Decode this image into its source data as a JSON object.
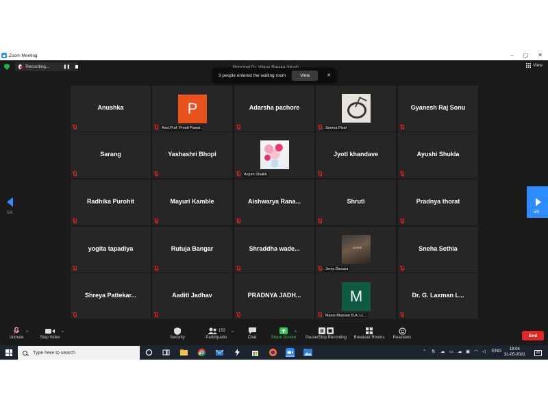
{
  "window": {
    "title": "Zoom Meeting",
    "controls": [
      "–",
      "▢",
      "✕"
    ]
  },
  "meeting_top": {
    "recording_label": "Recording...",
    "host_title": "Principal Dr. Vijaya Rajaka (Host)",
    "view_label": "View"
  },
  "notification": {
    "text": "3 people entered the waiting room",
    "view_button": "View",
    "close": "✕"
  },
  "navigation": {
    "page_left": "5/6",
    "page_right": "5/6"
  },
  "participants": [
    {
      "name": "Anushka",
      "type": "name"
    },
    {
      "name": "Asst.Prof. Preeti Pawar",
      "type": "avatar",
      "initial": "P",
      "color": "#e8521f"
    },
    {
      "name": "Adarsha pachore",
      "type": "name"
    },
    {
      "name": "Seema Pisal",
      "type": "photo",
      "photo": "sketch"
    },
    {
      "name": "Gyanesh Raj Sonu",
      "type": "name"
    },
    {
      "name": "Sarang",
      "type": "name"
    },
    {
      "name": "Yashashri Bhopi",
      "type": "name"
    },
    {
      "name": "Anjum Shaikh",
      "type": "photo",
      "photo": "flowers"
    },
    {
      "name": "Jyoti khandave",
      "type": "name"
    },
    {
      "name": "Ayushi Shukla",
      "type": "name"
    },
    {
      "name": "Radhika Purohit",
      "type": "name"
    },
    {
      "name": "Mayuri Kamble",
      "type": "name"
    },
    {
      "name": "Aishwarya  Rana...",
      "type": "name"
    },
    {
      "name": "Shruti",
      "type": "name"
    },
    {
      "name": "Pradnya thorat",
      "type": "name"
    },
    {
      "name": "yogita tapadiya",
      "type": "name"
    },
    {
      "name": "Rutuja Bangar",
      "type": "name"
    },
    {
      "name": "Shraddha  wade...",
      "type": "name"
    },
    {
      "name": "Jersy Dsouza",
      "type": "photo",
      "photo": "dark"
    },
    {
      "name": "Sneha Sethia",
      "type": "name"
    },
    {
      "name": "Shreya  Pattekar...",
      "type": "name"
    },
    {
      "name": "Aaditi Jadhav",
      "type": "name"
    },
    {
      "name": "PRADNYA  JADH...",
      "type": "name"
    },
    {
      "name": "Mansi Bhavsar B.A..LL...",
      "type": "avatar",
      "initial": "M",
      "color": "#0e5a42"
    },
    {
      "name": "Dr. G. Laxman L...",
      "type": "name"
    }
  ],
  "toolbar": {
    "unmute": "Unmute",
    "stop_video": "Stop Video",
    "security": "Security",
    "participants": "Participants",
    "participants_count": "152",
    "chat": "Chat",
    "share_screen": "Share Screen",
    "pause_recording": "Pause/Stop Recording",
    "breakout_rooms": "Breakout Rooms",
    "reactions": "Reactions",
    "end": "End"
  },
  "taskbar": {
    "search_placeholder": "Type here to search",
    "language": "ENG",
    "time": "18:04",
    "date": "31-05-2021",
    "notifications": "20"
  },
  "colors": {
    "zoom_blue": "#2d8cff",
    "end_red": "#e02828",
    "share_green": "#34c759",
    "meeting_bg": "#1a1a1a",
    "tile_bg": "#262626"
  }
}
